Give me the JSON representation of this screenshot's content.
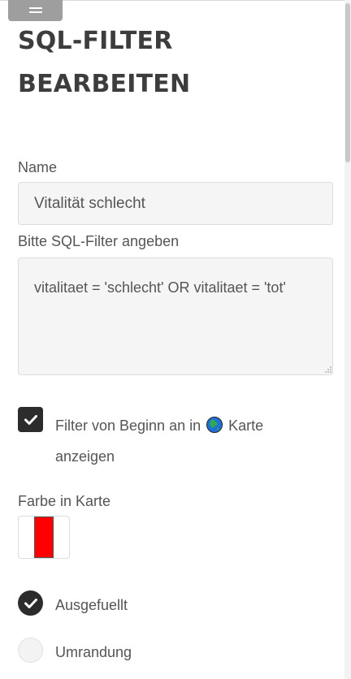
{
  "header": {
    "menu_icon": "hamburger-menu-icon",
    "title": "SQL-FILTER BEARBEITEN"
  },
  "form": {
    "name_label": "Name",
    "name_value": "Vitalität schlecht",
    "sql_label": "Bitte SQL-Filter angeben",
    "sql_value": "vitalitaet = 'schlecht' OR vitalitaet = 'tot'",
    "show_on_start": {
      "checked": true,
      "text_before": "Filter von Beginn an in",
      "icon": "globe-icon",
      "text_after": "Karte anzeigen"
    },
    "color_label": "Farbe in Karte",
    "color_value": "#ff0000",
    "fill_options": [
      {
        "label": "Ausgefuellt",
        "selected": true
      },
      {
        "label": "Umrandung",
        "selected": false
      }
    ]
  },
  "colors": {
    "accent": "#2c2c2c",
    "menu_button": "#9e9e9e",
    "input_bg": "#f5f5f5",
    "globe_water": "#1e6fd9",
    "globe_land": "#2fa84f"
  }
}
